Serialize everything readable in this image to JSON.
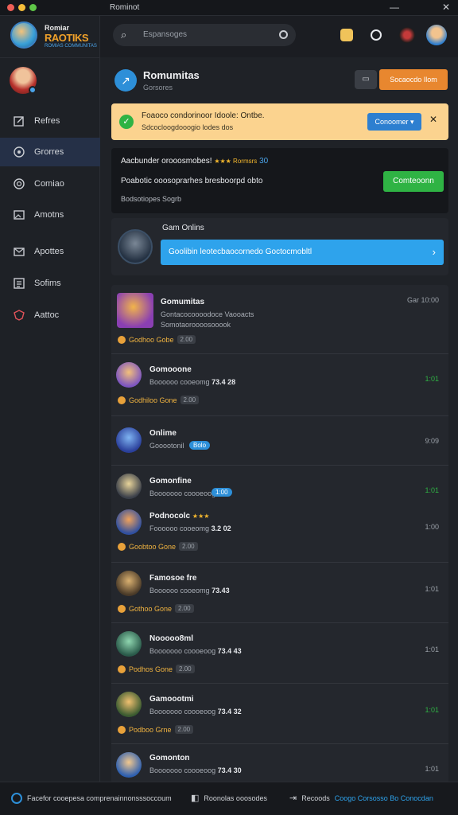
{
  "window": {
    "title": "Rominot"
  },
  "brand": {
    "line1": "Romiar",
    "line2": "RAOTIKS",
    "line3": "ROMIAS COMMUNITAS"
  },
  "nav": [
    {
      "label": "Refres",
      "icon": "edit-icon"
    },
    {
      "label": "Grorres",
      "icon": "games-icon"
    },
    {
      "label": "Comiao",
      "icon": "chat-icon"
    },
    {
      "label": "Amotns",
      "icon": "image-icon"
    },
    {
      "label": "Apottes",
      "icon": "mail-icon"
    },
    {
      "label": "Sofims",
      "icon": "settings-icon"
    },
    {
      "label": "Aattoc",
      "icon": "shield-icon"
    }
  ],
  "search": {
    "placeholder": "Espansoges"
  },
  "header": {
    "title": "Romumitas",
    "subtitle": "Gorsores",
    "action": "Socaocdo Ilom"
  },
  "notice": {
    "line1": "Foaoco condorinoor Idoole: Ontbe.",
    "line2": "Sdcocloogdooogio lodes dos",
    "button": "Conoomer"
  },
  "promo": {
    "line1": "Aacbunder orooosmobes!",
    "stars": "★★★ Rormsrs",
    "num": "30",
    "line2": "Poabotic ooosoprarhes bresboorpd obto",
    "line3": "Bodsotiopes Sogrb",
    "button": "Comteoonn"
  },
  "online": {
    "title": "Gam Onlins",
    "bar": "Goolibin leotecbaocornedo Goctocmobltl"
  },
  "rows": [
    {
      "name": "Gomumitas",
      "sub1": "Gontacocoooodoce Vaooacts",
      "sub2": "Somotaoroooosooook",
      "tag": "Godhoo Gobe",
      "pill": "2.00",
      "time": "",
      "meta": "Gar 10:00"
    },
    {
      "name": "Gomooone",
      "sub": "Boooooo cooeomg",
      "num": "73.4 28",
      "tag": "Godhiloo Gone",
      "pill": "2.00",
      "time": "1:01"
    },
    {
      "name": "Onlime",
      "sub": "Gooootonil",
      "badge": "Bolo",
      "time": "9:09"
    },
    {
      "name": "Gomonfine",
      "sub": "Booooooo coooeoog",
      "badge": "1:00",
      "time": "1:01"
    },
    {
      "name": "Podnocolc",
      "stars": "★★★",
      "sub": "Foooooo cooeomg",
      "num": "3.2 02",
      "tag": "Goobtoo Gone",
      "pill": "2.00",
      "time": "1:00"
    },
    {
      "name": "Famosoe fre",
      "sub": "Boooooo cooeomg",
      "num": "73.43",
      "tag": "Gothoo Gone",
      "pill": "2.00",
      "time": "1:01"
    },
    {
      "name": "Nooooo8ml",
      "sub": "Booooooo coooeoog",
      "num": "73.4 43",
      "tag": "Podhos Gone",
      "pill": "2.00",
      "time": "1:01"
    },
    {
      "name": "Gamoootmi",
      "sub": "Booooooo coooeoog",
      "num": "73.4 32",
      "tag": "Podboo Grne",
      "pill": "2.00",
      "time": "1:01"
    },
    {
      "name": "Gomonton",
      "sub": "Booooooo coooeoog",
      "num": "73.4 30",
      "time": "1:01"
    }
  ],
  "bottom": {
    "item1": "Facefor cooepesa comprenainnonsssoccoum",
    "item2": "Roonolas ooosodes",
    "item3": "Recoods",
    "item3b": "Coogo Corsosso Bo Conocdan"
  },
  "colors": {
    "accent": "#2d8fd8",
    "orange": "#e8872f",
    "green": "#2fb344",
    "notice": "#fbd38f"
  }
}
